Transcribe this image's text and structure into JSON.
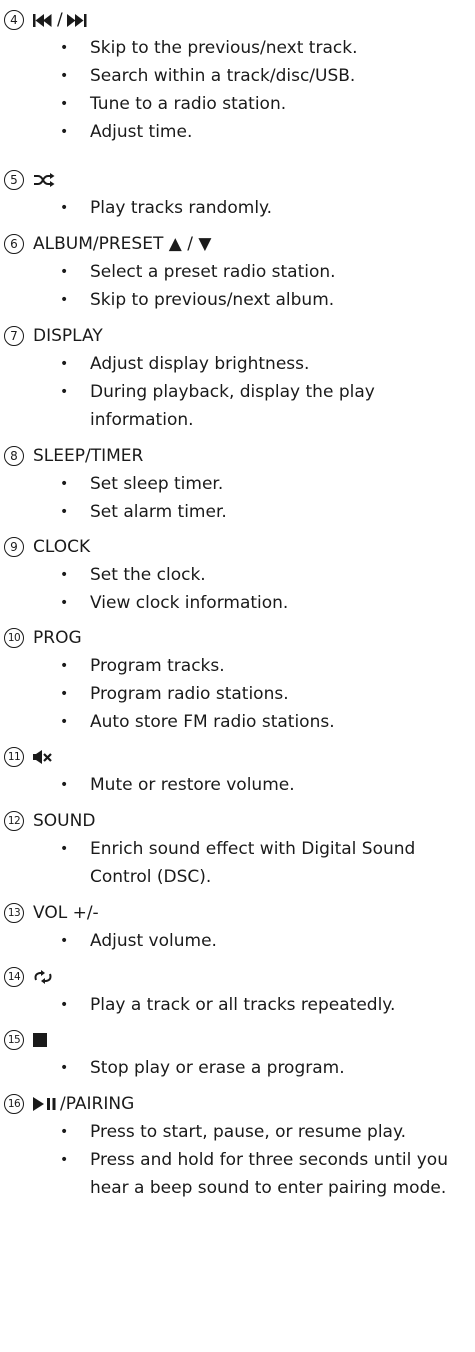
{
  "items": [
    {
      "num": "4",
      "title": "/",
      "icon": "skip-prev-next-icon",
      "bullets": [
        "Skip to the previous/next track.",
        "Search within a track/disc/USB.",
        "Tune to a radio station.",
        "Adjust time."
      ]
    },
    {
      "num": "5",
      "title": "",
      "icon": "shuffle-icon",
      "bullets": [
        "Play tracks randomly."
      ]
    },
    {
      "num": "6",
      "title": "ALBUM/PRESET ▲ / ▼",
      "icon": "",
      "bullets": [
        "Select a preset radio station.",
        "Skip to previous/next album."
      ]
    },
    {
      "num": "7",
      "title": "DISPLAY",
      "icon": "",
      "bullets": [
        "Adjust display brightness.",
        "During playback, display the play information."
      ]
    },
    {
      "num": "8",
      "title": "SLEEP/TIMER",
      "icon": "",
      "bullets": [
        "Set sleep timer.",
        "Set alarm timer."
      ]
    },
    {
      "num": "9",
      "title": "CLOCK",
      "icon": "",
      "bullets": [
        "Set the clock.",
        "View clock information."
      ]
    },
    {
      "num": "10",
      "title": "PROG",
      "icon": "",
      "bullets": [
        "Program tracks.",
        "Program radio stations.",
        "Auto store FM radio stations."
      ]
    },
    {
      "num": "11",
      "title": "",
      "icon": "mute-icon",
      "bullets": [
        "Mute or restore volume."
      ]
    },
    {
      "num": "12",
      "title": "SOUND",
      "icon": "",
      "bullets": [
        "Enrich sound effect with Digital Sound Control (DSC)."
      ]
    },
    {
      "num": "13",
      "title": "VOL +/-",
      "icon": "",
      "bullets": [
        "Adjust volume."
      ]
    },
    {
      "num": "14",
      "title": "",
      "icon": "repeat-icon",
      "bullets": [
        "Play a track or all tracks repeatedly."
      ]
    },
    {
      "num": "15",
      "title": "",
      "icon": "stop-icon",
      "bullets": [
        "Stop play or erase a program."
      ]
    },
    {
      "num": "16",
      "title": "/PAIRING",
      "icon": "play-pause-icon",
      "bullets": [
        "Press to start, pause, or resume play.",
        "Press and hold for three seconds until you hear a beep sound to enter pairing mode."
      ]
    }
  ]
}
